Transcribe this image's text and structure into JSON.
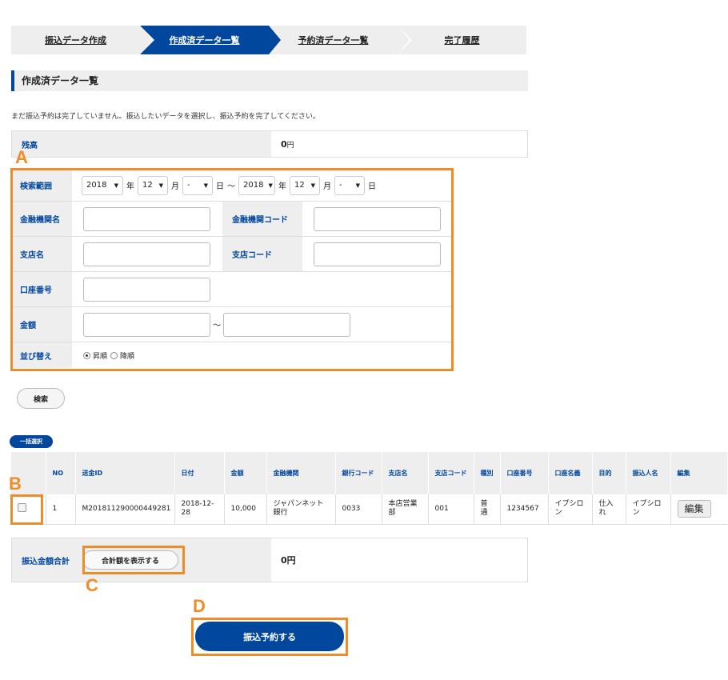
{
  "stepper": {
    "steps": [
      {
        "label": "振込データ作成",
        "active": false
      },
      {
        "label": "作成済データ一覧",
        "active": true
      },
      {
        "label": "予約済データ一覧",
        "active": false
      },
      {
        "label": "完了履歴",
        "active": false
      }
    ]
  },
  "section_title": "作成済データ一覧",
  "notice": "まだ振込予約は完了していません。振込したいデータを選択し、振込予約を完了してください。",
  "balance": {
    "label": "残高",
    "value": "0",
    "unit": "円"
  },
  "search": {
    "range_label": "検索範囲",
    "from_year": "2018",
    "from_month": "12",
    "from_day": "-",
    "to_year": "2018",
    "to_month": "12",
    "to_day": "-",
    "year_unit": "年",
    "month_unit": "月",
    "day_unit": "日",
    "tilde": "～",
    "bank_name_label": "金融機関名",
    "bank_code_label": "金融機関コード",
    "branch_name_label": "支店名",
    "branch_code_label": "支店コード",
    "account_label": "口座番号",
    "amount_label": "金額",
    "amount_tilde": "～",
    "sort_label": "並び替え",
    "sort_asc": "昇順",
    "sort_desc": "降順",
    "sort_selected": "asc"
  },
  "search_button": "検索",
  "bulk_select_button": "一括選択",
  "table": {
    "headers": [
      "",
      "NO",
      "送金ID",
      "日付",
      "金額",
      "金融機関",
      "銀行コード",
      "支店名",
      "支店コード",
      "種別",
      "口座番号",
      "口座名義",
      "目的",
      "振込人名",
      "編集"
    ],
    "rows": [
      {
        "no": "1",
        "id": "M201811290000449281",
        "date": "2018-12-28",
        "amount": "10,000",
        "bank": "ジャパンネット銀行",
        "bank_code": "0033",
        "branch": "本店営業部",
        "branch_code": "001",
        "type": "普通",
        "account": "1234567",
        "holder": "イプシロン",
        "purpose": "仕入れ",
        "payer": "イプシロン",
        "edit": "編集"
      }
    ]
  },
  "total": {
    "label": "振込金額合計",
    "button": "合計額を表示する",
    "value": "0円"
  },
  "submit_button": "振込予約する",
  "annotations": {
    "a": "A",
    "b": "B",
    "c": "C",
    "d": "D"
  },
  "colors": {
    "primary": "#00479d",
    "annotation": "#ee8c2a",
    "label_bg": "#eeeeee"
  }
}
